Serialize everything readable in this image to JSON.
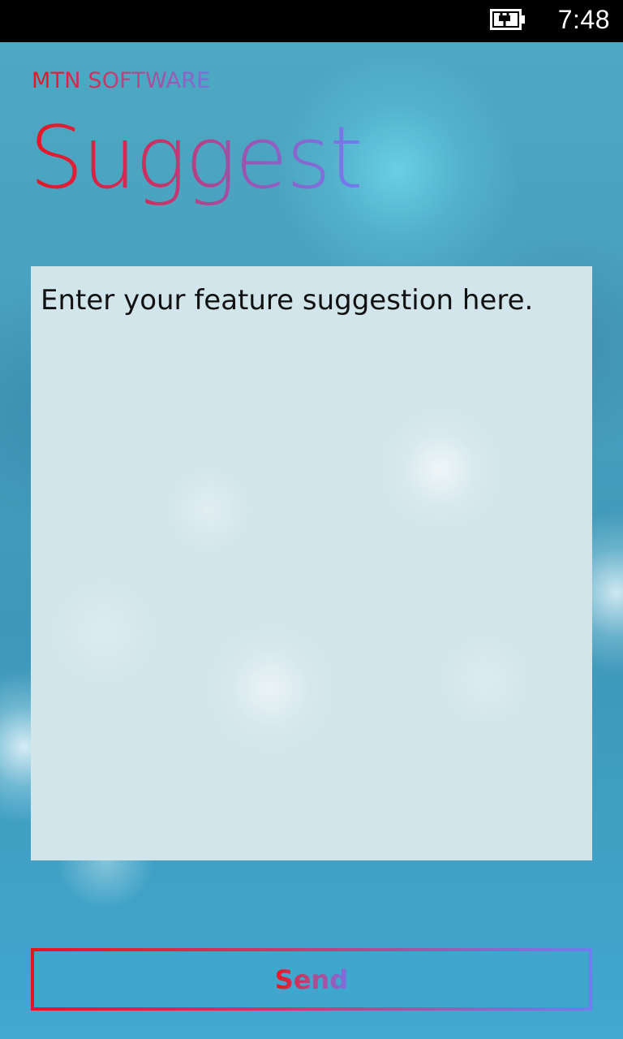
{
  "status_bar": {
    "battery_icon": "battery-charging-icon",
    "time": "7:48"
  },
  "header": {
    "app_name": "MTN SOFTWARE",
    "page_title": "Suggest"
  },
  "suggestion": {
    "value": "",
    "placeholder": "Enter your feature suggestion here."
  },
  "actions": {
    "send_label": "Send"
  },
  "colors": {
    "accent_start": "#e8151f",
    "accent_end": "#6f7df0",
    "background": "#41a0c4"
  }
}
